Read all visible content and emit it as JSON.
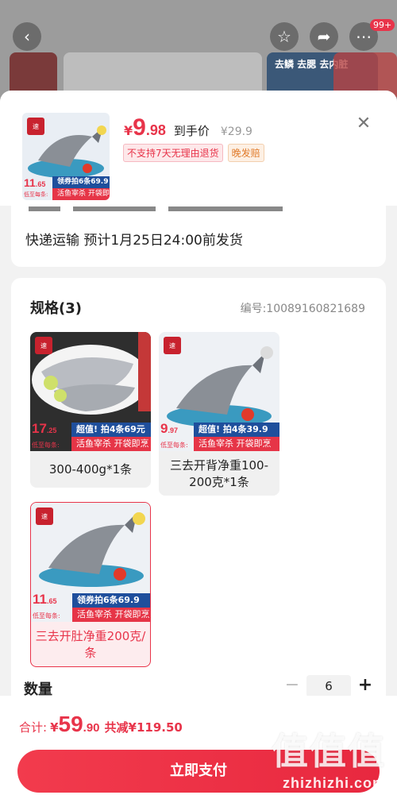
{
  "background": {
    "banner_text": "去鳞 去腮 去内脏",
    "more_badge": "99+"
  },
  "product": {
    "yen": "¥",
    "price_int": "9",
    "price_dec": ".98",
    "price_label": "到手价",
    "original_price": "¥29.9",
    "tags": [
      "不支持7天无理由退货",
      "晚发赔"
    ],
    "thumb_promo": {
      "num": "11",
      "num_small": ".65",
      "blue": "领券拍6条69.9",
      "low": "低至每条:",
      "red": "活鱼宰杀 开袋即烹"
    }
  },
  "shipping": {
    "text": "快递运输 预计1月25日24:00前发货"
  },
  "spec": {
    "title": "规格(3)",
    "code": "编号:10089160821689",
    "options": [
      {
        "label": "300-400g*1条",
        "promo_num": "17",
        "promo_small": ".25",
        "promo_blue": "超值! 拍4条69元",
        "promo_low": "低至每条:",
        "promo_red": "活鱼宰杀 开袋即烹",
        "selected": false
      },
      {
        "label": "三去开背净重100-200克*1条",
        "promo_num": "9",
        "promo_small": ".97",
        "promo_blue": "超值! 拍4条39.9",
        "promo_low": "低至每条:",
        "promo_red": "活鱼宰杀 开袋即烹",
        "selected": false
      },
      {
        "label": "三去开肚净重200克/条",
        "promo_num": "11",
        "promo_small": ".65",
        "promo_blue": "领券拍6条69.9",
        "promo_low": "低至每条:",
        "promo_red": "活鱼宰杀 开袋即烹",
        "selected": true
      }
    ]
  },
  "quantity": {
    "label": "数量",
    "minus": "−",
    "value": "6",
    "plus": "+"
  },
  "total": {
    "label": "合计:",
    "yen": "¥",
    "amount_int": "59",
    "amount_dec": ".90",
    "saved": "共减¥119.50"
  },
  "pay_button": "立即支付",
  "watermark": {
    "glyph": "值值值",
    "site": "zhizhizhi.com"
  },
  "colors": {
    "accent": "#e8344a",
    "promo_blue": "#1f4f9c"
  },
  "icons": [
    "back-icon",
    "star-icon",
    "share-icon",
    "more-icon",
    "close-icon"
  ]
}
